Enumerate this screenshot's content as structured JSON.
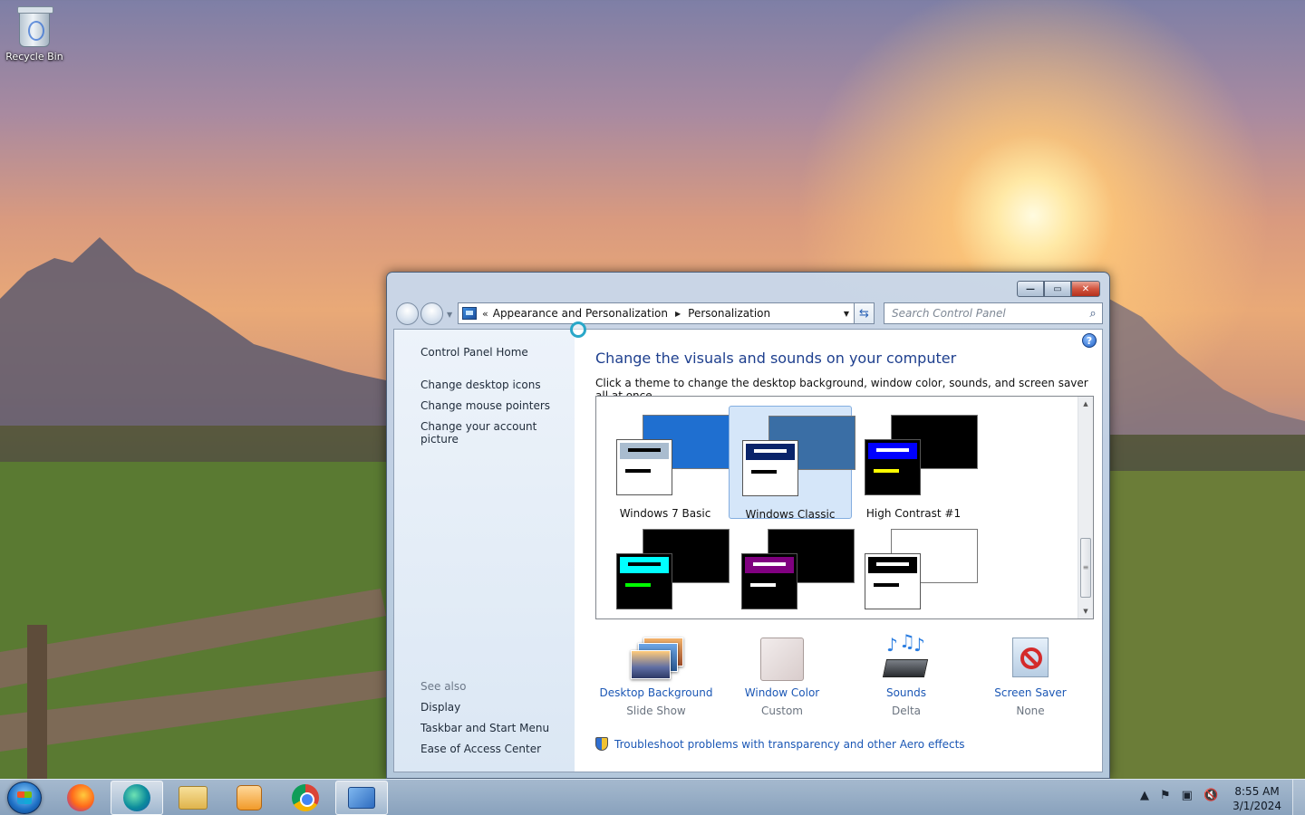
{
  "desktop": {
    "icons": [
      {
        "label": "Recycle Bin",
        "icon": "recycle-bin-icon"
      }
    ]
  },
  "window": {
    "caption_buttons": {
      "minimize": "—",
      "maximize": "▭",
      "close": "✕"
    },
    "address": {
      "separator": "«",
      "crumbs": [
        "Appearance and Personalization",
        "Personalization"
      ],
      "crumb_arrow": "▶",
      "dropdown": "▼"
    },
    "refresh_glyph": "⇆",
    "search": {
      "placeholder": "Search Control Panel",
      "icon_glyph": "⌕"
    },
    "left_pane": {
      "home": "Control Panel Home",
      "tasks": [
        "Change desktop icons",
        "Change mouse pointers",
        "Change your account picture"
      ],
      "see_also_heading": "See also",
      "see_also": [
        "Display",
        "Taskbar and Start Menu",
        "Ease of Access Center"
      ]
    },
    "main": {
      "help_glyph": "?",
      "title": "Change the visuals and sounds on your computer",
      "subtitle": "Click a theme to change the desktop background, window color, sounds, and screen saver all at once.",
      "themes": [
        {
          "label": "Windows 7 Basic",
          "selected": false,
          "back_color": "#1f6fd0",
          "title_color": "#a9bccf",
          "bar1": "#000000",
          "bar2": "#000000",
          "win_bg": "#ffffff"
        },
        {
          "label": "Windows Classic",
          "selected": true,
          "back_color": "#3a6ea5",
          "title_color": "#0a246a",
          "bar1": "#ffffff",
          "bar2": "#000000",
          "win_bg": "#ffffff"
        },
        {
          "label": "High Contrast #1",
          "selected": false,
          "back_color": "#000000",
          "title_color": "#0000ff",
          "bar1": "#ffffff",
          "bar2": "#ffff00",
          "win_bg": "#000000"
        },
        {
          "label": "",
          "selected": false,
          "back_color": "#000000",
          "title_color": "#00ffff",
          "bar1": "#000000",
          "bar2": "#00ff00",
          "win_bg": "#000000"
        },
        {
          "label": "",
          "selected": false,
          "back_color": "#000000",
          "title_color": "#800080",
          "bar1": "#ffffff",
          "bar2": "#ffffff",
          "win_bg": "#000000"
        },
        {
          "label": "",
          "selected": false,
          "back_color": "#ffffff",
          "title_color": "#000000",
          "bar1": "#ffffff",
          "bar2": "#000000",
          "win_bg": "#ffffff"
        }
      ],
      "scroll_up": "▲",
      "scroll_down": "▼",
      "scroll_grip": "≡",
      "settings": [
        {
          "name": "Desktop Background",
          "value": "Slide Show",
          "icon": "desktop-background-icon"
        },
        {
          "name": "Window Color",
          "value": "Custom",
          "icon": "window-color-icon"
        },
        {
          "name": "Sounds",
          "value": "Delta",
          "icon": "sounds-icon"
        },
        {
          "name": "Screen Saver",
          "value": "None",
          "icon": "screen-saver-icon"
        }
      ],
      "troubleshoot": "Troubleshoot problems with transparency and other Aero effects"
    }
  },
  "taskbar": {
    "items": [
      {
        "icon": "firefox-icon",
        "active": false
      },
      {
        "icon": "edge-icon",
        "active": true
      },
      {
        "icon": "file-explorer-icon",
        "active": false
      },
      {
        "icon": "media-player-icon",
        "active": false
      },
      {
        "icon": "chrome-icon",
        "active": false
      },
      {
        "icon": "control-panel-icon",
        "active": true
      }
    ],
    "tray": {
      "show_hidden": "▲",
      "flag": "⚑",
      "network": "▣",
      "volume": "🔇"
    },
    "clock": {
      "time": "8:55 AM",
      "date": "3/1/2024"
    }
  }
}
